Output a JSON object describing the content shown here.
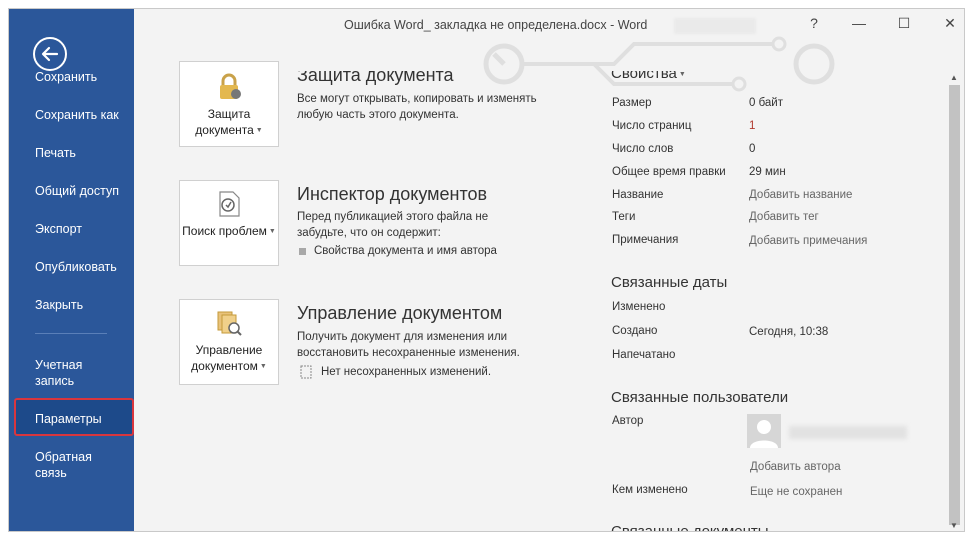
{
  "window": {
    "title": "Ошибка Word_ закладка не определена.docx - Word",
    "help": "?",
    "minimize": "—",
    "maximize": "☐",
    "close": "✕"
  },
  "sidebar": {
    "items": [
      {
        "label": "Сохранить"
      },
      {
        "label": "Сохранить как"
      },
      {
        "label": "Печать"
      },
      {
        "label": "Общий доступ"
      },
      {
        "label": "Экспорт"
      },
      {
        "label": "Опубликовать"
      },
      {
        "label": "Закрыть"
      },
      {
        "label": "Учетная запись"
      },
      {
        "label": "Параметры"
      },
      {
        "label": "Обратная связь"
      }
    ],
    "selected": "Параметры"
  },
  "sections": [
    {
      "tile_label": "Защита документа",
      "title": "Защита документа",
      "description": "Все могут открывать, копировать и изменять любую часть этого документа."
    },
    {
      "tile_label": "Поиск проблем",
      "title": "Инспектор документов",
      "description": "Перед публикацией этого файла не забудьте, что он содержит:",
      "items": [
        "Свойства документа и имя автора"
      ]
    },
    {
      "tile_label": "Управление документом",
      "title": "Управление документом",
      "description": "Получить документ для изменения или восстановить несохраненные изменения.",
      "items": [
        "Нет несохраненных изменений."
      ]
    }
  ],
  "properties": {
    "header": "Свойства",
    "rows": [
      {
        "label": "Размер",
        "value": "0 байт"
      },
      {
        "label": "Число страниц",
        "value": "1"
      },
      {
        "label": "Число слов",
        "value": "0"
      },
      {
        "label": "Общее время правки",
        "value": "29 мин"
      },
      {
        "label": "Название",
        "value": "Добавить название"
      },
      {
        "label": "Теги",
        "value": "Добавить тег"
      },
      {
        "label": "Примечания",
        "value": "Добавить примечания"
      }
    ],
    "dates_header": "Связанные даты",
    "dates": [
      {
        "label": "Изменено",
        "value": ""
      },
      {
        "label": "Создано",
        "value": "Сегодня, 10:38"
      },
      {
        "label": "Напечатано",
        "value": ""
      }
    ],
    "people_header": "Связанные пользователи",
    "author_label": "Автор",
    "add_author": "Добавить автора",
    "modified_by_label": "Кем изменено",
    "modified_by_value": "Еще не сохранен",
    "docs_header": "Связанные документы"
  },
  "colors": {
    "sidebar_bg": "#2b579a",
    "selected_outline": "#d9363e"
  }
}
